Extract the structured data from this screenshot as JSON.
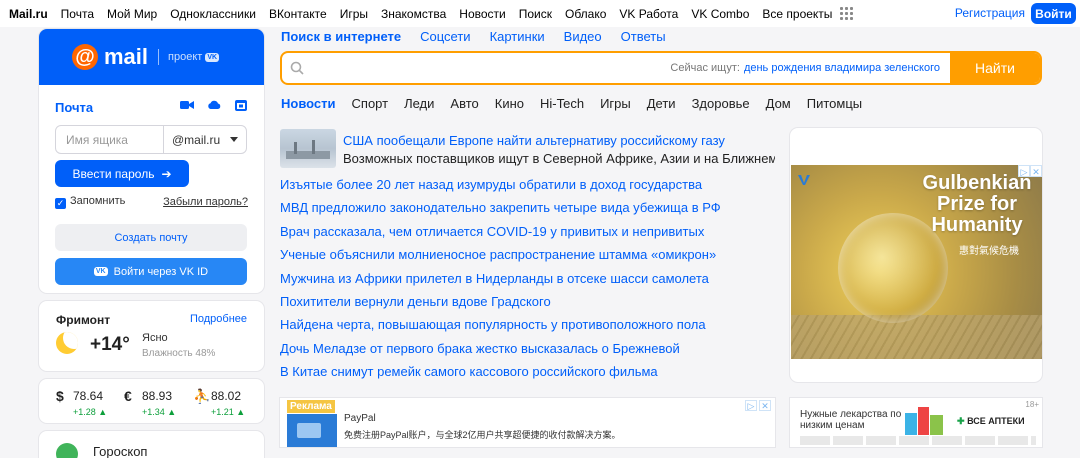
{
  "topnav": {
    "items": [
      "Mail.ru",
      "Почта",
      "Мой Мир",
      "Одноклассники",
      "ВКонтакте",
      "Игры",
      "Знакомства",
      "Новости",
      "Поиск",
      "Облако",
      "VK Работа",
      "VK Combo",
      "Все проекты"
    ],
    "register": "Регистрация",
    "login": "Войти"
  },
  "mail": {
    "logo_text": "mail",
    "project_label": "проект",
    "project_badge": "VK",
    "title": "Почта",
    "login_placeholder": "Имя ящика",
    "domain": "@mail.ru",
    "enter_password": "Ввести пароль",
    "remember": "Запомнить",
    "forgot": "Забыли пароль?",
    "create": "Создать почту",
    "vkid": "Войти через VK ID",
    "vkid_badge": "VK"
  },
  "weather": {
    "city": "Фримонт",
    "more": "Подробнее",
    "temp": "+14°",
    "condition": "Ясно",
    "humidity": "Влажность 48%"
  },
  "rates": [
    {
      "symbol": "$",
      "value": "78.64",
      "change": "+1.28 ▲"
    },
    {
      "symbol": "€",
      "value": "88.93",
      "change": "+1.34 ▲"
    },
    {
      "symbol": "⛹",
      "value": "88.02",
      "change": "+1.21 ▲"
    }
  ],
  "horoscope": {
    "title": "Гороскоп"
  },
  "search": {
    "tabs": [
      "Поиск в интернете",
      "Соцсети",
      "Картинки",
      "Видео",
      "Ответы"
    ],
    "now_label": "Сейчас ищут:",
    "now_query": "день рождения владимира зеленского",
    "button": "Найти"
  },
  "news_tabs": [
    "Новости",
    "Спорт",
    "Леди",
    "Авто",
    "Кино",
    "Hi-Tech",
    "Игры",
    "Дети",
    "Здоровье",
    "Дом",
    "Питомцы"
  ],
  "news": {
    "featured_title": "США пообещали Европе найти альтернативу российскому газу",
    "featured_sub": "Возможных поставщиков ищут в Северной Африке, Азии и на Ближнем Востоке",
    "items": [
      "Изъятые более 20 лет назад изумруды обратили в доход государства",
      "МВД предложило законодательно закрепить четыре вида убежища в РФ",
      "Врач рассказала, чем отличается COVID-19 у привитых и непривитых",
      "Ученые объяснили молниеносное распространение штамма «омикрон»",
      "Мужчина из Африки прилетел в Нидерланды в отсеке шасси самолета",
      "Похитители вернули деньги вдове Градского",
      "Найдена черта, повышающая популярность у противоположного пола",
      "Дочь Меладзе от первого брака жестко высказалась о Брежневой",
      "В Китае снимут ремейк самого кассового российского фильма"
    ]
  },
  "ad_paypal": {
    "label": "Реклама",
    "name": "PayPal",
    "text": "免费注册PayPal账户，与全球2亿用户共享超便捷的收付款解决方案。"
  },
  "banner": {
    "title": "Gulbenkian Prize for Humanity",
    "subtitle": "惠對氣候危機"
  },
  "ad_apteka": {
    "title": "Нужные лекарства по низким ценам",
    "brand": "ВСЕ АПТЕКИ",
    "brand_plus": "✚",
    "age": "18+"
  }
}
